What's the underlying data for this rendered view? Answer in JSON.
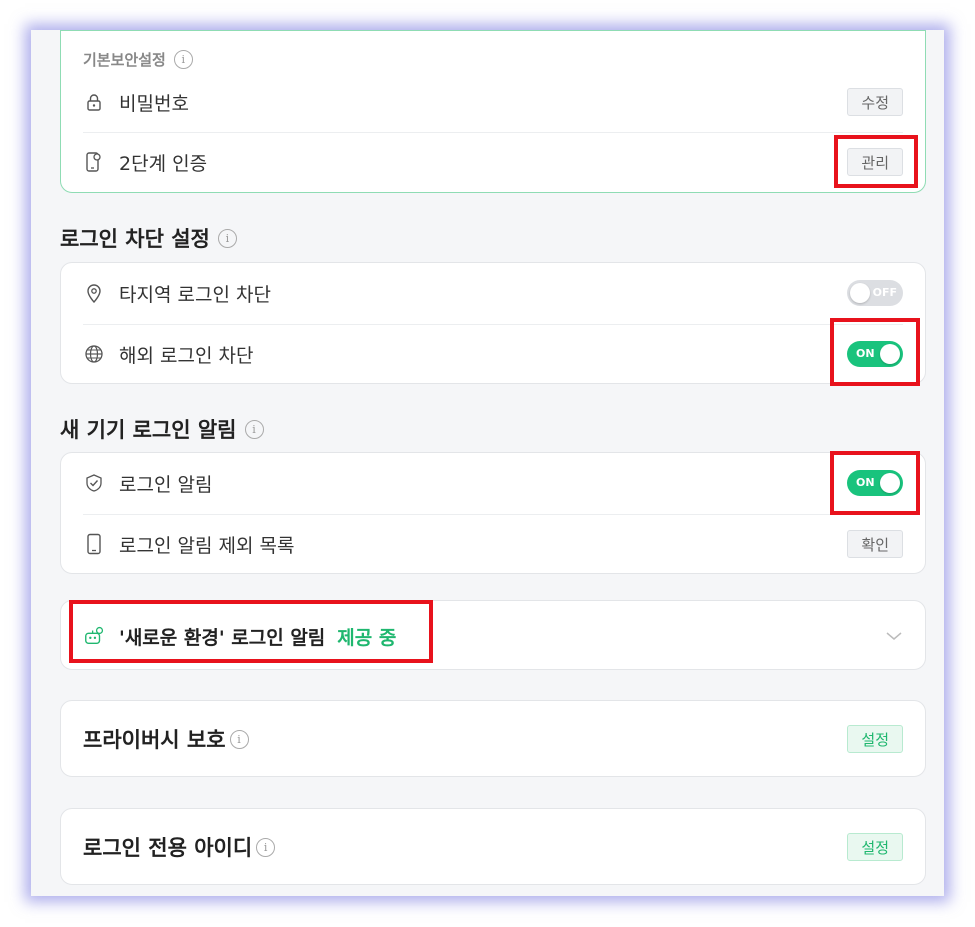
{
  "basic_security": {
    "heading": "기본보안설정",
    "rows": [
      {
        "icon": "lock-icon",
        "label": "비밀번호",
        "button": "수정"
      },
      {
        "icon": "phone-key-icon",
        "label": "2단계 인증",
        "button": "관리"
      }
    ]
  },
  "login_block": {
    "title": "로그인 차단 설정",
    "rows": [
      {
        "icon": "location-pin-icon",
        "label": "타지역 로그인 차단",
        "toggle": "OFF"
      },
      {
        "icon": "globe-icon",
        "label": "해외 로그인 차단",
        "toggle": "ON"
      }
    ]
  },
  "new_device": {
    "title": "새 기기 로그인 알림",
    "rows": [
      {
        "icon": "shield-check-icon",
        "label": "로그인 알림",
        "toggle": "ON"
      },
      {
        "icon": "mobile-device-icon",
        "label": "로그인 알림 제외 목록",
        "button": "확인"
      }
    ]
  },
  "new_env": {
    "label": "'새로운 환경' 로그인 알림",
    "status": "제공 중"
  },
  "privacy": {
    "title": "프라이버시 보호",
    "button": "설정"
  },
  "login_id": {
    "title": "로그인 전용 아이디",
    "button": "설정"
  },
  "colors": {
    "accent_green": "#19c37d",
    "highlight_red": "#e8121c"
  }
}
